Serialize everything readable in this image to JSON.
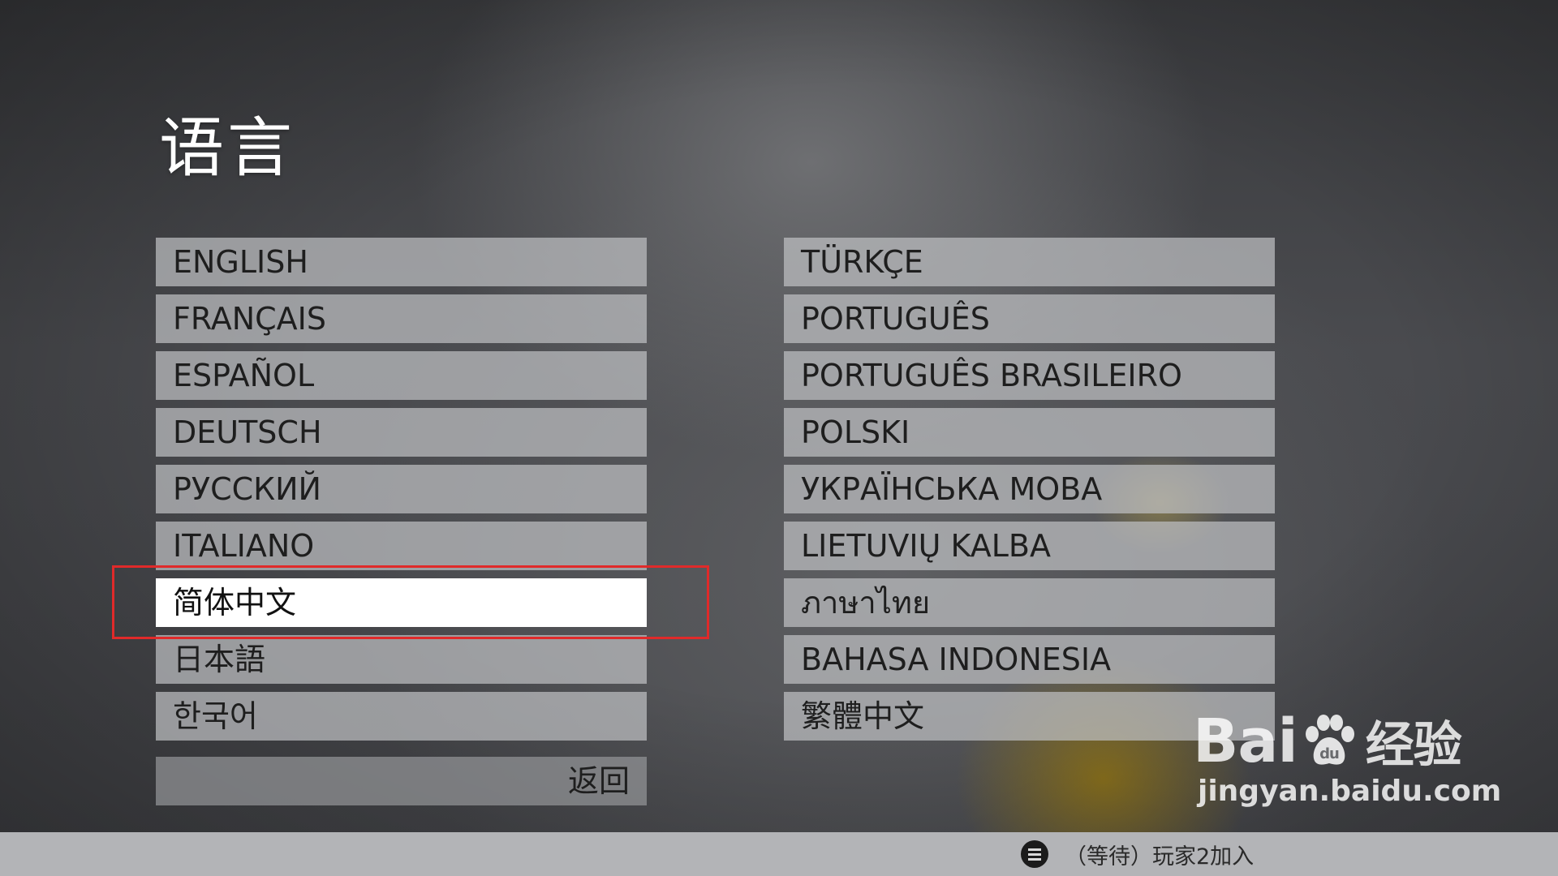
{
  "screen": {
    "title": "语言"
  },
  "languages": {
    "left": [
      {
        "label": "ENGLISH"
      },
      {
        "label": "FRANÇAIS"
      },
      {
        "label": "ESPAÑOL"
      },
      {
        "label": "DEUTSCH"
      },
      {
        "label": "РУССКИЙ"
      },
      {
        "label": "ITALIANO"
      },
      {
        "label": "简体中文",
        "selected": true
      },
      {
        "label": "日本語"
      },
      {
        "label": "한국어"
      }
    ],
    "right": [
      {
        "label": "TÜRKÇE"
      },
      {
        "label": "PORTUGUÊS"
      },
      {
        "label": "PORTUGUÊS BRASILEIRO"
      },
      {
        "label": "POLSKI"
      },
      {
        "label": "УКРАЇНСЬКА МОВА"
      },
      {
        "label": "LIETUVIŲ KALBA"
      },
      {
        "label": "ภาษาไทย"
      },
      {
        "label": "BAHASA INDONESIA"
      },
      {
        "label": "繁體中文"
      }
    ]
  },
  "back_button": {
    "label": "返回"
  },
  "status_bar": {
    "icon": "menu-icon",
    "text": "（等待）玩家2加入"
  },
  "watermark": {
    "logo_prefix": "Bai",
    "logo_mid": "du",
    "logo_suffix": "经验",
    "url": "jingyan.baidu.com"
  },
  "colors": {
    "highlight_border": "#e02a2a",
    "selected_bg": "#ffffff",
    "button_bg": "#bebfc2",
    "status_bar_bg": "#b3b4b7"
  }
}
